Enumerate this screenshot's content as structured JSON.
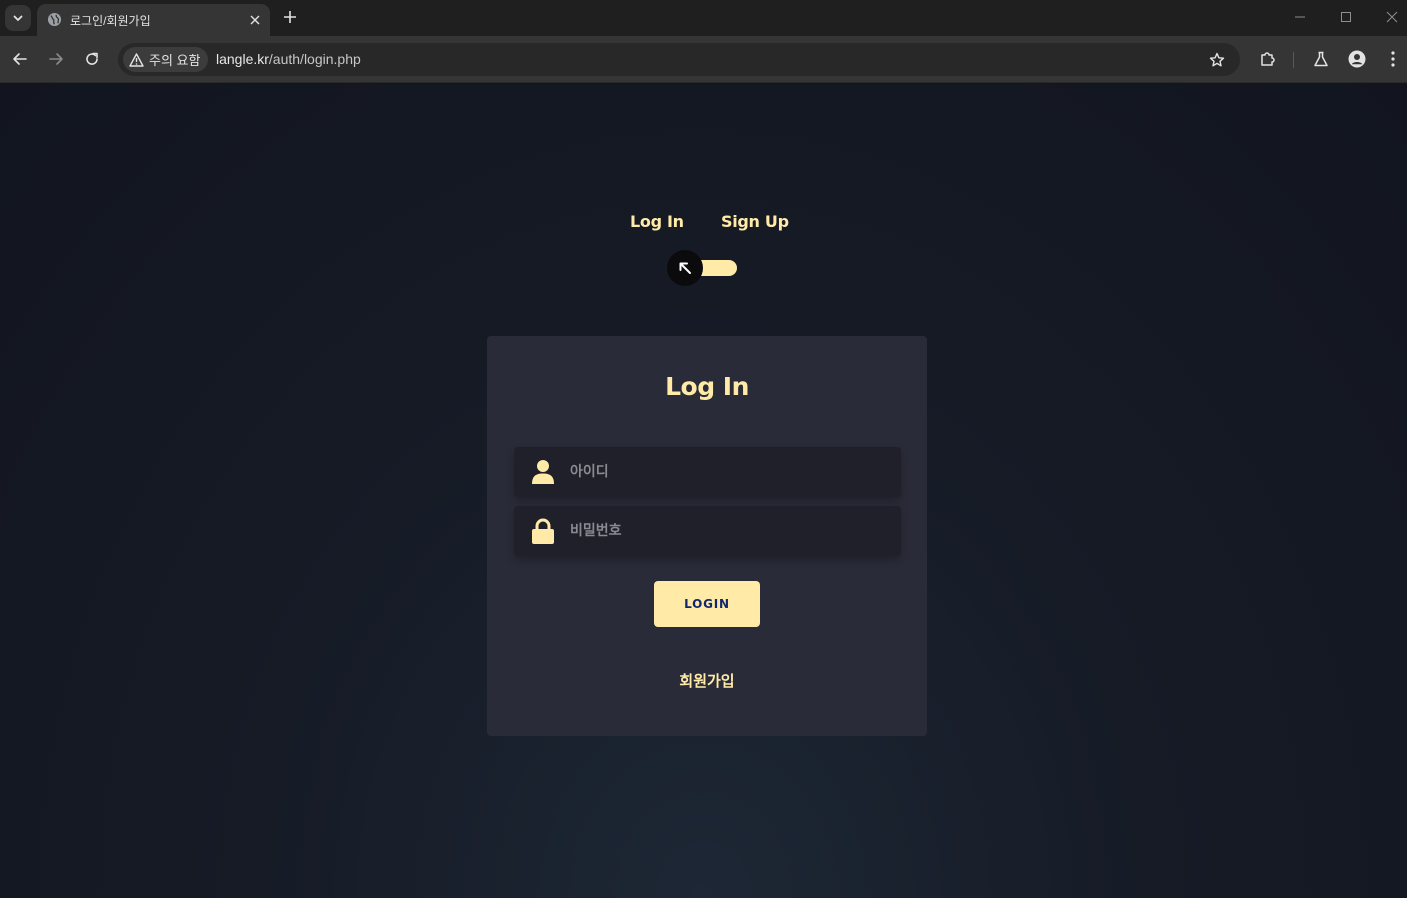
{
  "browser": {
    "tab": {
      "title": "로그인/회원가입",
      "favicon": "globe-icon"
    },
    "security_chip": {
      "label": "주의 요함",
      "icon": "warning-icon"
    },
    "url": {
      "host": "langle.kr",
      "path": "/auth/login.php"
    }
  },
  "page": {
    "mode_tabs": {
      "login": "Log In",
      "signup": "Sign Up"
    },
    "card": {
      "title": "Log In",
      "username": {
        "placeholder": "아이디",
        "icon": "user-icon"
      },
      "password": {
        "placeholder": "비밀번호",
        "icon": "lock-icon"
      },
      "login_button": "LOGIN",
      "signup_link": "회원가입"
    }
  },
  "colors": {
    "accent": "#ffeba7",
    "card": "#2a2b38",
    "field": "#1f2029",
    "background": "#12151f"
  }
}
